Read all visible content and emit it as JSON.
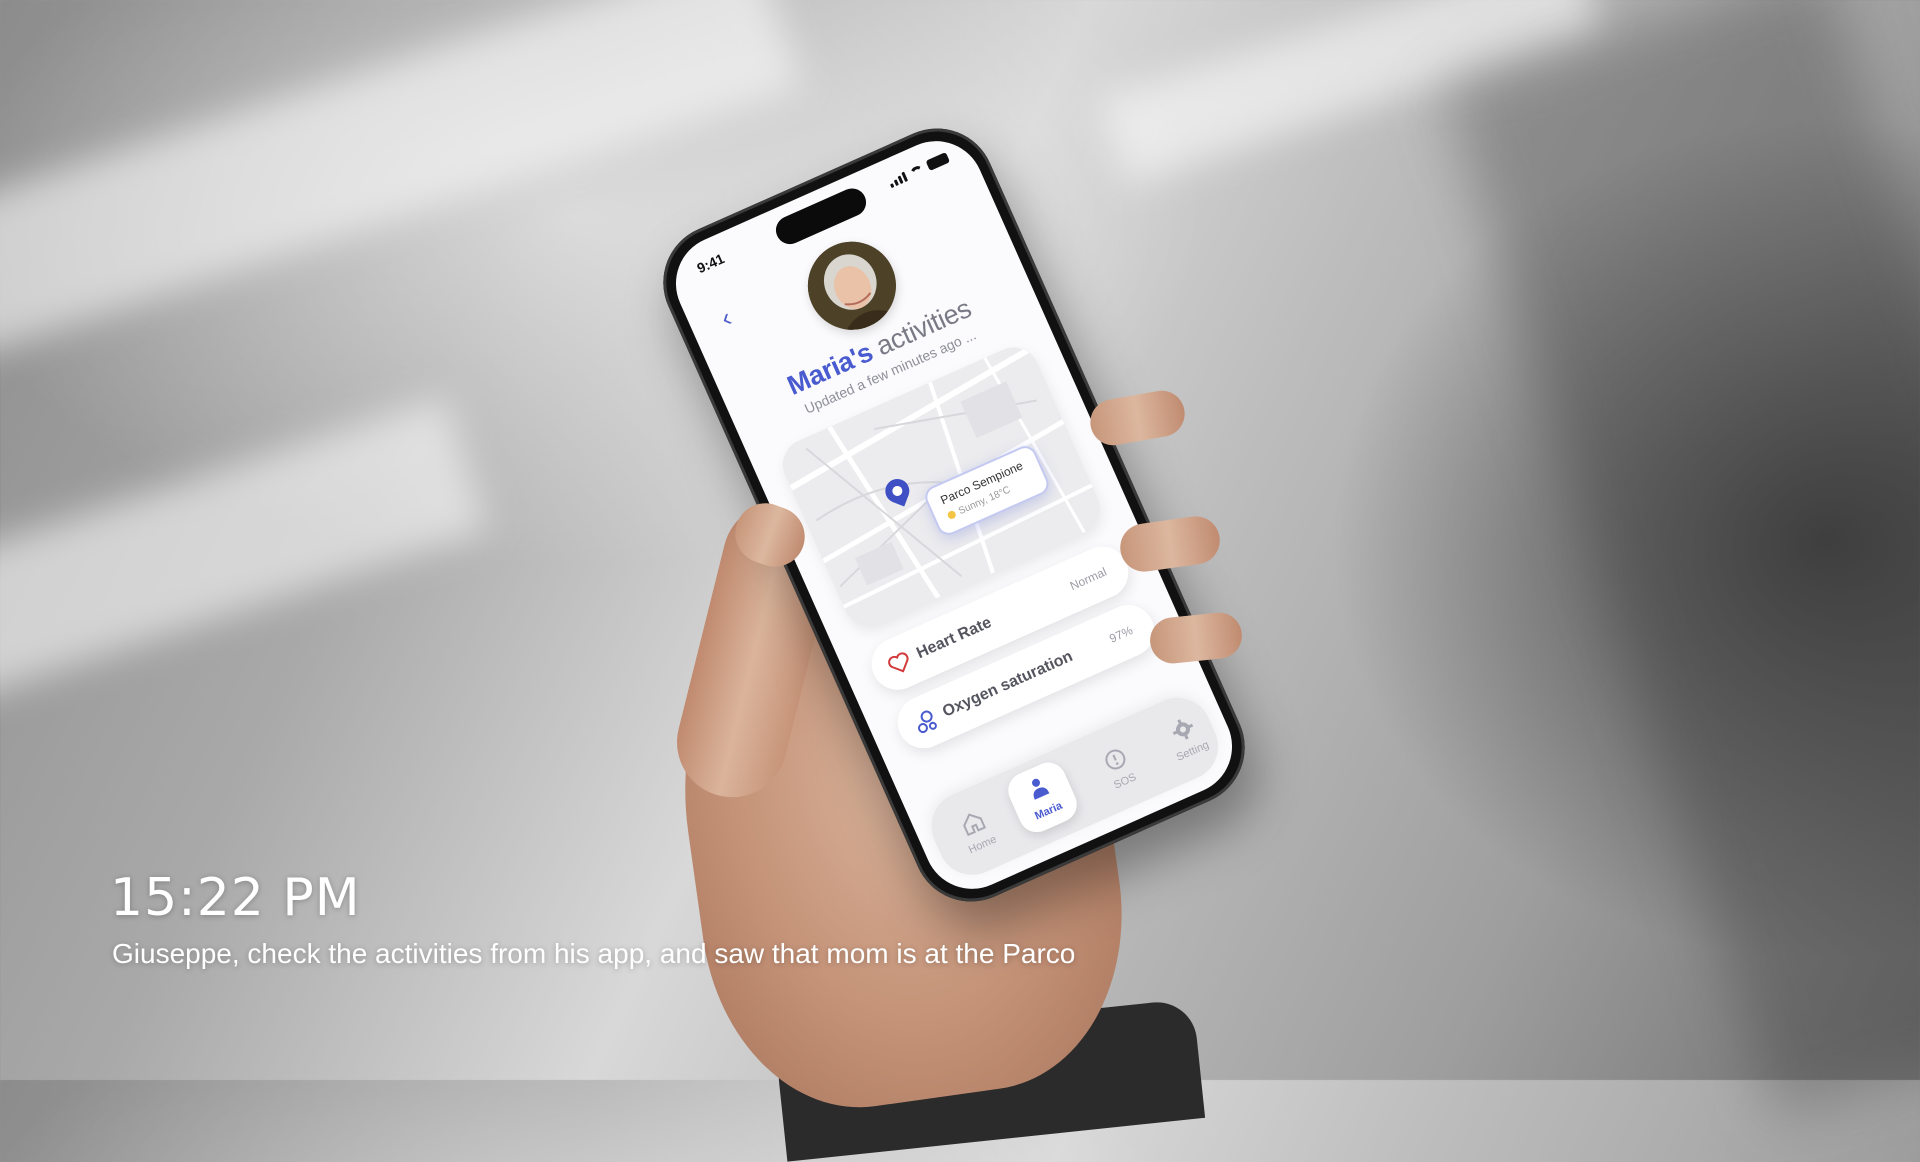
{
  "caption": {
    "time": "15:22  PM",
    "text": "Giuseppe, check the activities from his app, and saw that mom is at the Parco"
  },
  "phone": {
    "status_time": "9:41",
    "title_name": "Maria's",
    "title_rest": " activities",
    "subtitle": "Updated a few minutes ago ...",
    "map": {
      "place_name": "Parco Sempione",
      "weather": "Sunny, 18°C"
    },
    "cards": [
      {
        "label": "Heart Rate",
        "value": "Normal",
        "icon": "heart-icon"
      },
      {
        "label": "Oxygen saturation",
        "value": "97%",
        "icon": "oxygen-icon"
      }
    ],
    "tabs": [
      {
        "label": "Home",
        "icon": "home-icon"
      },
      {
        "label": "Maria",
        "icon": "person-icon"
      },
      {
        "label": "SOS",
        "icon": "alert-icon"
      },
      {
        "label": "Setting",
        "icon": "gear-icon"
      }
    ],
    "accent_color": "#4a5bd0"
  }
}
